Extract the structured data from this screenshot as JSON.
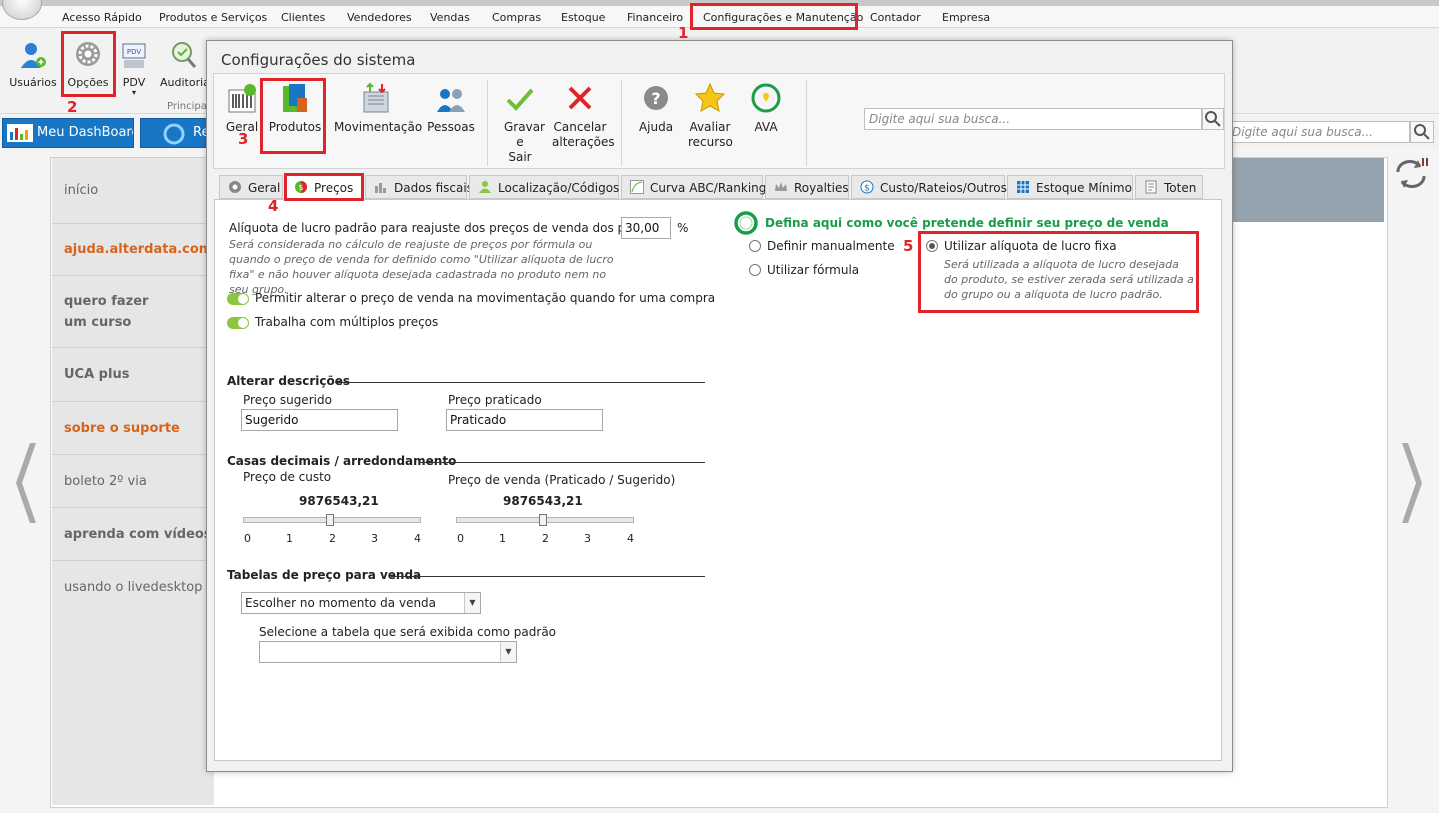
{
  "menu": {
    "items": [
      "Acesso Rápido",
      "Produtos e Serviços",
      "Clientes",
      "Vendedores",
      "Vendas",
      "Compras",
      "Estoque",
      "Financeiro",
      "Configurações e Manutenção",
      "Contador",
      "Empresa"
    ]
  },
  "ribbon": {
    "buttons": [
      "Usuários",
      "Opções",
      "PDV",
      "Auditoria"
    ],
    "group_label": "Principal"
  },
  "dashboard": {
    "tab_dashboard": "Meu DashBoard",
    "tab_second": "Re",
    "search_placeholder": "Digite aqui sua busca..."
  },
  "sidebar": {
    "items": [
      "início",
      "ajuda.alterdata.com.br",
      "quero fazer um curso",
      "UCA plus",
      "sobre o suporte",
      "boleto 2º via",
      "aprenda com vídeos",
      "usando o livedesktop"
    ]
  },
  "dialog": {
    "title": "Configurações do sistema",
    "toolbar": {
      "buttons": [
        "Geral",
        "Produtos",
        "Movimentação",
        "Pessoas",
        "Gravar e Sair",
        "Cancelar alterações",
        "Ajuda",
        "Avaliar recurso",
        "AVA"
      ],
      "search_placeholder": "Digite aqui sua busca..."
    },
    "tabs": [
      "Geral",
      "Preços",
      "Dados fiscais",
      "Localização/Códigos",
      "Curva ABC/Ranking",
      "Royalties",
      "Custo/Rateios/Outros",
      "Estoque Mínimo",
      "Toten"
    ],
    "active_tab": "Preços",
    "precos": {
      "aliquota_label": "Alíquota de lucro padrão para reajuste dos preços de venda dos produtos",
      "aliquota_value": "30,00",
      "aliquota_unit": "%",
      "aliquota_hint": "Será considerada no cálculo de reajuste de preços por fórmula ou quando o preço de venda for definido como \"Utilizar alíquota de lucro fixa\" e não houver alíquota desejada cadastrada no produto nem no seu grupo.",
      "toggle_alterar": "Permitir alterar o preço de venda na movimentação quando for uma compra",
      "toggle_multiplos": "Trabalha com múltiplos preços",
      "descricoes_title": "Alterar descrições",
      "sugerido_label": "Preço sugerido",
      "sugerido_value": "Sugerido",
      "praticado_label": "Preço praticado",
      "praticado_value": "Praticado",
      "casas_title": "Casas decimais / arredondamento",
      "custo_label": "Preço de custo",
      "custo_sample": "9876543,21",
      "venda_label": "Preço de venda (Praticado / Sugerido)",
      "venda_sample": "9876543,21",
      "custo_level": 2,
      "venda_level": 2,
      "ticks": [
        "0",
        "1",
        "2",
        "3",
        "4"
      ],
      "tabelas_title": "Tabelas de preço para venda",
      "tabela_select": "Escolher no momento da venda",
      "tabela_padrao_label": "Selecione a tabela que será exibida como padrão",
      "tabela_padrao_value": "",
      "definir_title": "Defina aqui como você pretende definir seu preço de venda",
      "opt_manual": "Definir manualmente",
      "opt_formula": "Utilizar fórmula",
      "opt_fixa": "Utilizar alíquota de lucro fixa",
      "opt_fixa_hint": "Será utilizada a alíquota de lucro desejada do produto, se estiver zerada será utilizada a do grupo ou a alíquota de lucro padrão.",
      "selected_option": "Utilizar alíquota de lucro fixa"
    }
  },
  "annotations": [
    "1",
    "2",
    "3",
    "4",
    "5"
  ],
  "colors": {
    "annotation_red": "#e0242b",
    "accent_blue": "#1976c5",
    "orange_link": "#d5651d",
    "toggle_green": "#8cc63f",
    "heading_green": "#1a9c4a"
  }
}
